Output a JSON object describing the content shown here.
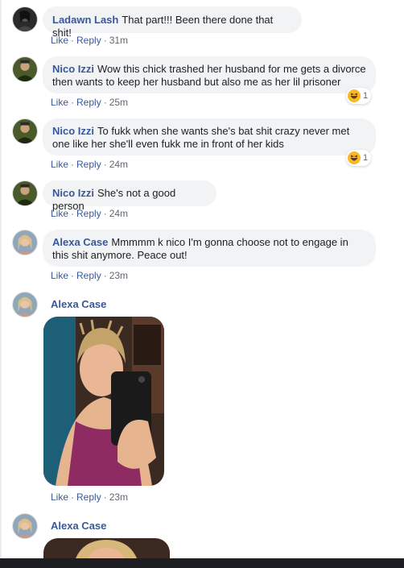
{
  "actions": {
    "like": "Like",
    "reply": "Reply"
  },
  "comments": [
    {
      "author": "Ladawn Lash",
      "text": "That part!!! Been there done that shit!",
      "time": "31m"
    },
    {
      "author": "Nico Izzi",
      "text": "Wow this chick trashed her husband for me gets a divorce then wants to keep her husband but also me as her lil prisoner",
      "time": "25m",
      "reaction": {
        "emoji": "laughing-emoji",
        "count": "1"
      }
    },
    {
      "author": "Nico Izzi",
      "text": "To fukk when she wants she's bat shit crazy never met one like her she'll even fukk me in front of her kids",
      "time": "24m",
      "reaction": {
        "emoji": "laughing-emoji",
        "count": "1"
      }
    },
    {
      "author": "Nico Izzi",
      "text": "She's not a good person",
      "time": "24m"
    },
    {
      "author": "Alexa Case",
      "text": "Mmmmm k nico I'm gonna choose not to engage in this shit anymore. Peace out!",
      "time": "23m"
    },
    {
      "author": "Alexa Case",
      "text": "",
      "time": "23m",
      "attachment": "photo"
    },
    {
      "author": "Alexa Case",
      "attachment": "photo"
    }
  ],
  "colors": {
    "author": "#385898",
    "bubble": "#f2f3f5",
    "meta": "#606770",
    "reaction": "#f7b928"
  }
}
